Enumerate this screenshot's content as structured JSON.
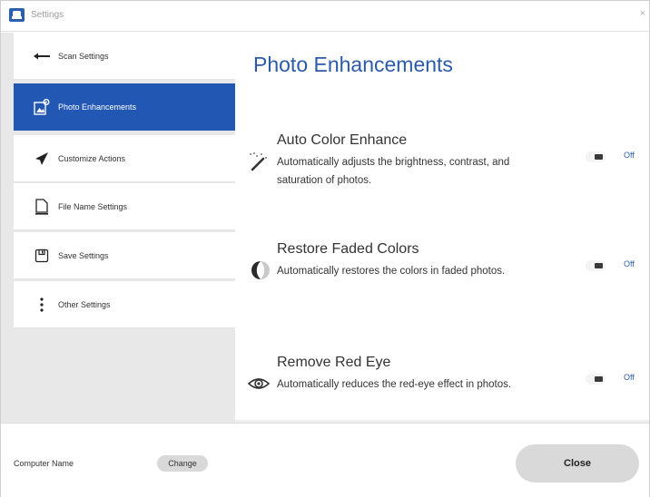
{
  "window": {
    "title": "Settings",
    "close_glyph": "×"
  },
  "sidebar": {
    "items": [
      {
        "label": "Scan Settings",
        "icon": "back-arrow-icon",
        "active": false
      },
      {
        "label": "Photo Enhancements",
        "icon": "photo-enhance-icon",
        "active": true
      },
      {
        "label": "Customize Actions",
        "icon": "send-arrow-icon",
        "active": false
      },
      {
        "label": "File Name Settings",
        "icon": "document-icon",
        "active": false
      },
      {
        "label": "Save Settings",
        "icon": "save-icon",
        "active": false
      },
      {
        "label": "Other Settings",
        "icon": "vertical-ellipsis-icon",
        "active": false
      }
    ]
  },
  "main": {
    "title": "Photo Enhancements",
    "options": [
      {
        "title": "Auto Color Enhance",
        "description": "Automatically adjusts the brightness, contrast, and saturation of photos.",
        "icon": "magic-wand-icon",
        "state": "Off"
      },
      {
        "title": "Restore Faded Colors",
        "description": "Automatically restores the colors in faded photos.",
        "icon": "half-circle-icon",
        "state": "Off"
      },
      {
        "title": "Remove Red Eye",
        "description": "Automatically reduces the red-eye effect in photos.",
        "icon": "eye-icon",
        "state": "Off"
      }
    ]
  },
  "footer": {
    "computer_name_label": "Computer Name",
    "change_label": "Change",
    "close_label": "Close"
  },
  "colors": {
    "accent": "#2258b4",
    "title_blue": "#2a5aa8",
    "sidebar_bg": "#e8e8e8",
    "button_gray": "#d9d9d9"
  }
}
